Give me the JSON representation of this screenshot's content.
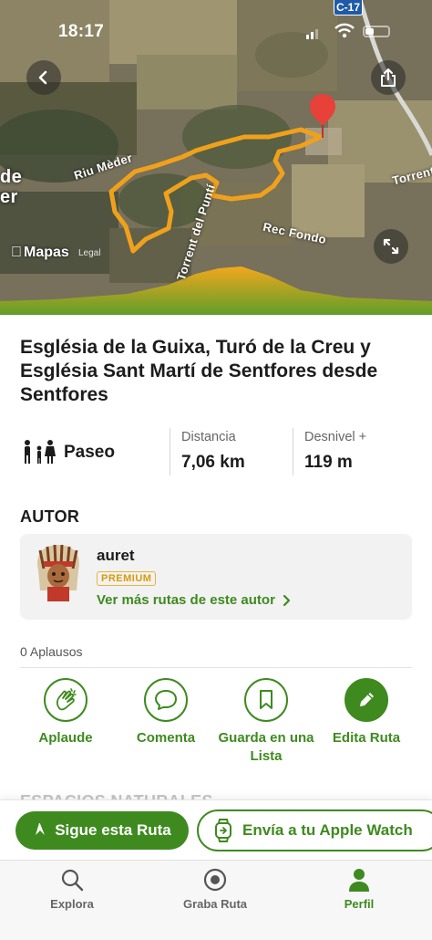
{
  "status_bar": {
    "time": "18:17",
    "road_tag": "C-17"
  },
  "map": {
    "labels": {
      "river": "Riu Mèder",
      "torrent": "Torrent del Puntí",
      "rec": "Rec Fondo",
      "torre": "Torrent",
      "partial": "de\ner"
    },
    "brand": "Mapas",
    "legal": "Legal"
  },
  "route": {
    "title": "Església de la Guixa, Turó de la Creu y Església Sant Martí de Sentfores desde Sentfores",
    "type": "Paseo",
    "distance_label": "Distancia",
    "distance_value": "7,06 km",
    "elevation_label": "Desnivel +",
    "elevation_value": "119 m"
  },
  "author": {
    "heading": "AUTOR",
    "name": "auret",
    "badge": "PREMIUM",
    "link": "Ver más rutas de este autor"
  },
  "social": {
    "applause_count": "0 Aplausos"
  },
  "actions": [
    {
      "label": "Aplaude",
      "icon": "clap-icon"
    },
    {
      "label": "Comenta",
      "icon": "comment-icon"
    },
    {
      "label": "Guarda en una Lista",
      "icon": "bookmark-icon"
    },
    {
      "label": "Edita Ruta",
      "icon": "pencil-icon"
    }
  ],
  "next_section": "ESPACIOS NATURALES",
  "cta": {
    "primary": "Sigue esta Ruta",
    "secondary": "Envía a tu Apple Watch"
  },
  "tabs": [
    {
      "label": "Explora",
      "icon": "search-icon"
    },
    {
      "label": "Graba Ruta",
      "icon": "record-icon"
    },
    {
      "label": "Perfil",
      "icon": "profile-icon",
      "active": true
    }
  ],
  "colors": {
    "accent": "#3e8a1f",
    "route": "#f0a11c",
    "premium": "#d79a0b"
  }
}
